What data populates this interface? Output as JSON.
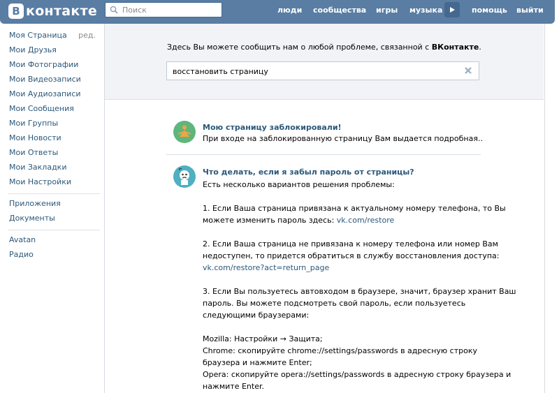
{
  "header": {
    "logo_letter": "В",
    "logo_text": "контакте",
    "search_placeholder": "Поиск",
    "nav": [
      "люди",
      "сообщества",
      "игры",
      "музыка",
      "помощь",
      "выйти"
    ]
  },
  "sidebar": {
    "edit_label": "ред.",
    "items": [
      "Моя Страница",
      "Мои Друзья",
      "Мои Фотографии",
      "Мои Видеозаписи",
      "Мои Аудиозаписи",
      "Мои Сообщения",
      "Мои Группы",
      "Мои Новости",
      "Мои Ответы",
      "Мои Закладки",
      "Мои Настройки"
    ],
    "items2": [
      "Приложения",
      "Документы"
    ],
    "items3": [
      "Avatan",
      "Радио"
    ]
  },
  "support": {
    "intro_prefix": "Здесь Вы можете сообщить нам о любой проблеме, связанной с",
    "intro_brand": "ВКонтакте",
    "intro_suffix": ".",
    "query": "восстановить страницу"
  },
  "results": [
    {
      "title": "Мою страницу заблокировали!",
      "snippet": "При входе на заблокированную страницу Вам выдается подробная.."
    },
    {
      "title": "Что делать, если я забыл пароль от страницы?",
      "line1": "Есть несколько вариантов решения проблемы:",
      "p1a": "1. Если Ваша страница привязана к актуальному номеру телефона, то Вы",
      "p1b": "можете изменить пароль здесь:",
      "p1link": "vk.com/restore",
      "p2a": "2. Если Ваша страница не привязана к номеру телефона или номер Вам",
      "p2b": "недоступен, то придется обратиться в службу восстановления доступа:",
      "p2link": "vk.com/restore?act=return_page",
      "p3a": "3. Если Вы пользуетесь автовходом в браузере, значит, браузер хранит Ваш",
      "p3b": "пароль. Вы можете подсмотреть свой пароль, если пользуетесь",
      "p3c": "следующими браузерами:",
      "b1": "Mozilla: Настройки → Защита;",
      "b2a": "Chrome: скопируйте chrome://settings/passwords в адресную строку",
      "b2b": "браузера и нажмите Enter;",
      "b3a": "Opera: скопируйте opera://settings/passwords в адресную строку браузера и",
      "b3b": "нажмите Enter."
    }
  ],
  "colors": {
    "header": "#597da3",
    "link": "#2b587a",
    "panel": "#f1f3f6"
  }
}
